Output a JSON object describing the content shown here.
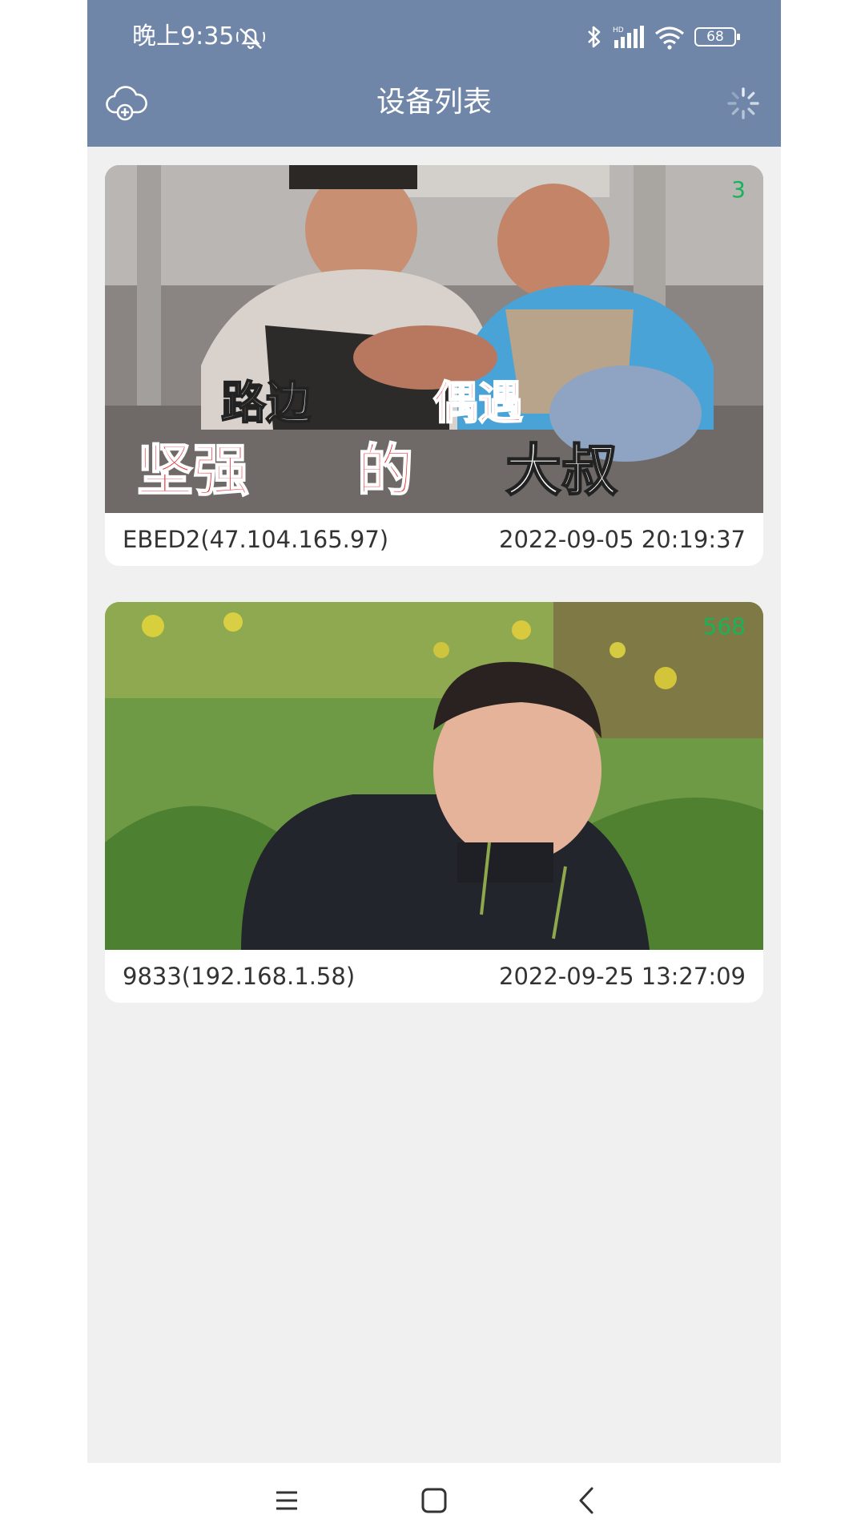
{
  "status_bar": {
    "time": "晚上9:35",
    "battery": "68",
    "icons": [
      "mute-icon",
      "bluetooth-icon",
      "hd-signal-icon",
      "wifi-icon",
      "battery-icon"
    ]
  },
  "header": {
    "title": "设备列表",
    "left_icon": "cloud-add-icon",
    "right_icon": "loading-spinner-icon",
    "background": "#6f86a8"
  },
  "devices": [
    {
      "count": "3",
      "name": "EBED2(47.104.165.97)",
      "time": "2022-09-05 20:19:37",
      "thumbnail_caption_line1a": "路边",
      "thumbnail_caption_line1b": "偶遇",
      "thumbnail_caption_line2a": "坚强",
      "thumbnail_caption_line2b": "的",
      "thumbnail_caption_line2c": "大叔"
    },
    {
      "count": "568",
      "name": "9833(192.168.1.58)",
      "time": "2022-09-25 13:27:09"
    }
  ],
  "nav": {
    "icons": [
      "menu-icon",
      "home-icon",
      "back-icon"
    ]
  },
  "colors": {
    "count_green": "#16b35a",
    "background": "#f0f0f0"
  }
}
